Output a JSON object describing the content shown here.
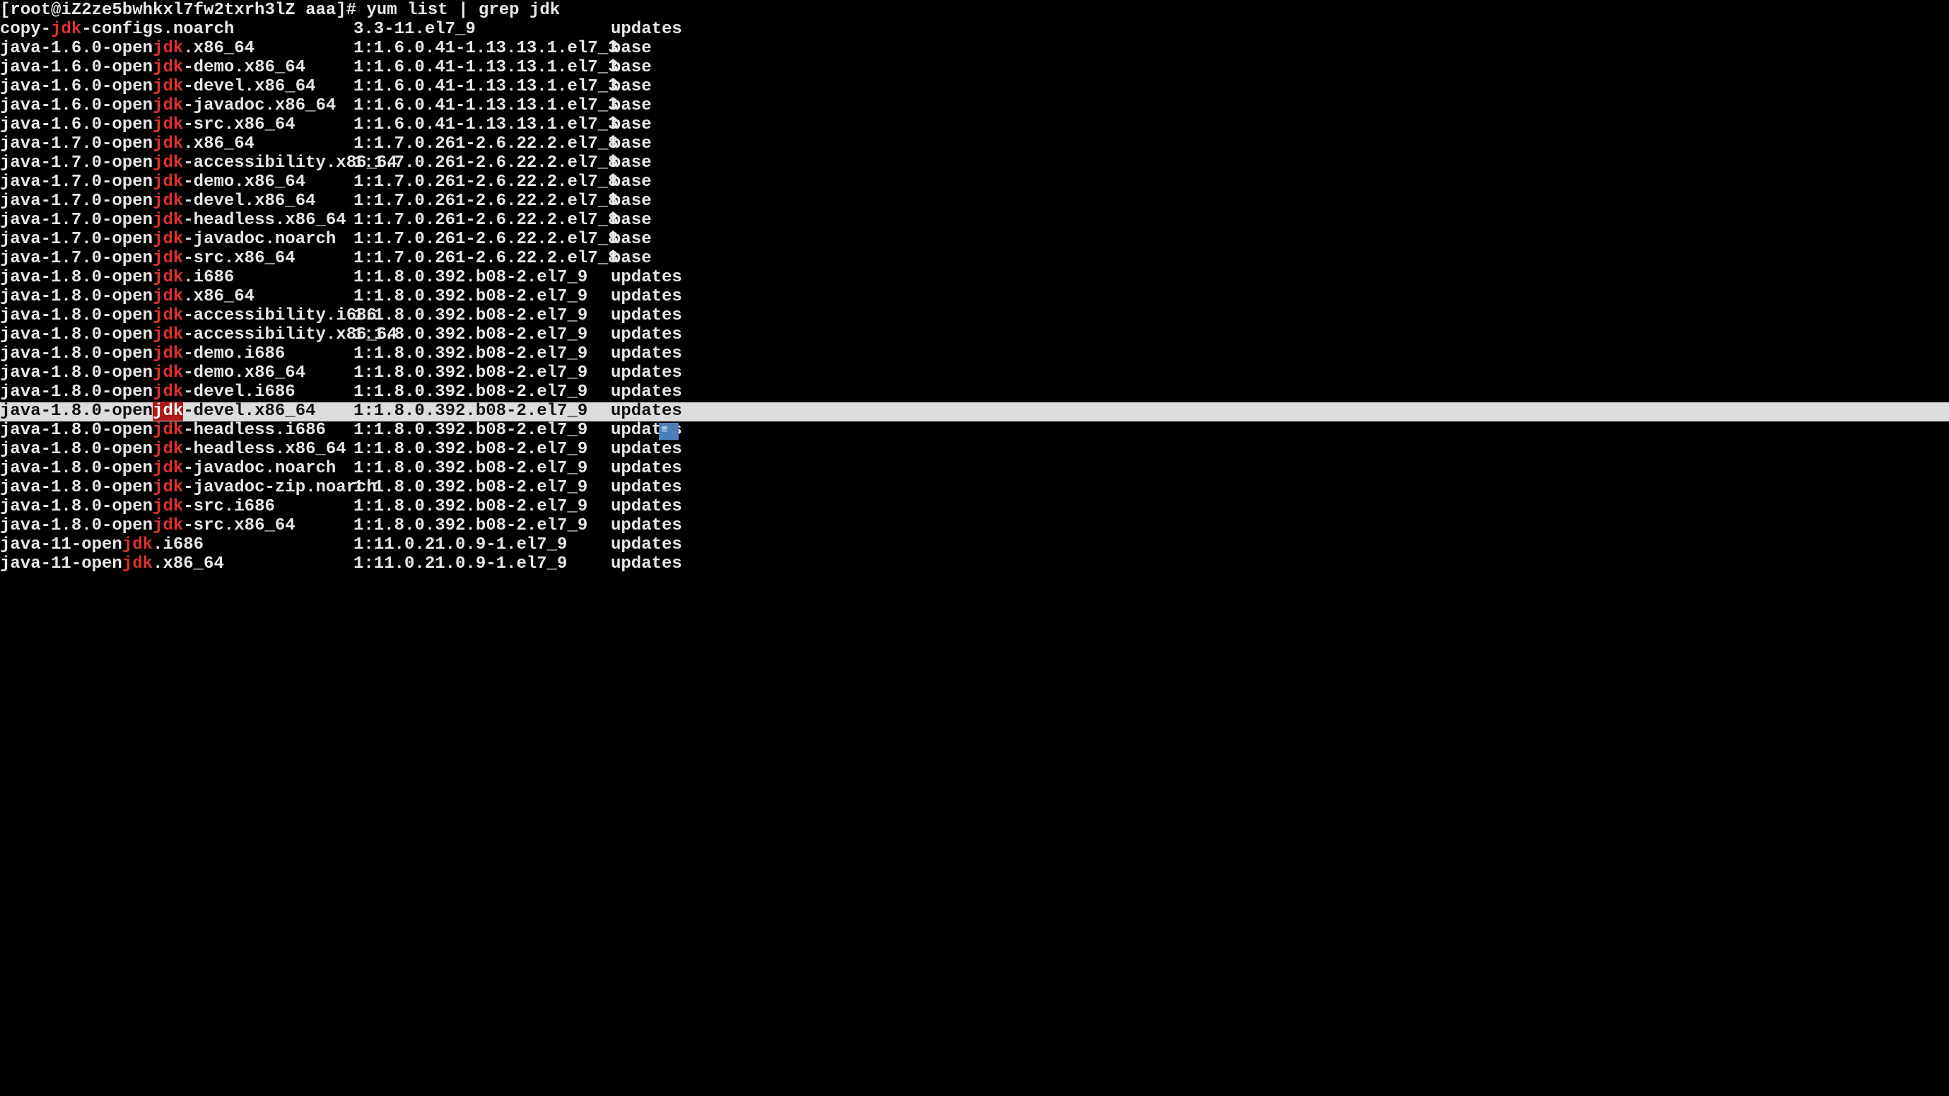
{
  "prompt": "[root@iZ2ze5bwhkxl7fw2txrh3lZ aaa]# yum list | grep jdk",
  "rows": [
    {
      "pre": "copy-",
      "mid": "jdk",
      "post": "-configs.noarch",
      "ver": "3.3-11.el7_9",
      "repo": "updates",
      "sel": false
    },
    {
      "pre": "java-1.6.0-open",
      "mid": "jdk",
      "post": ".x86_64",
      "ver": "1:1.6.0.41-1.13.13.1.el7_3",
      "repo": "base",
      "sel": false
    },
    {
      "pre": "java-1.6.0-open",
      "mid": "jdk",
      "post": "-demo.x86_64",
      "ver": "1:1.6.0.41-1.13.13.1.el7_3",
      "repo": "base",
      "sel": false
    },
    {
      "pre": "java-1.6.0-open",
      "mid": "jdk",
      "post": "-devel.x86_64",
      "ver": "1:1.6.0.41-1.13.13.1.el7_3",
      "repo": "base",
      "sel": false
    },
    {
      "pre": "java-1.6.0-open",
      "mid": "jdk",
      "post": "-javadoc.x86_64",
      "ver": "1:1.6.0.41-1.13.13.1.el7_3",
      "repo": "base",
      "sel": false
    },
    {
      "pre": "java-1.6.0-open",
      "mid": "jdk",
      "post": "-src.x86_64",
      "ver": "1:1.6.0.41-1.13.13.1.el7_3",
      "repo": "base",
      "sel": false
    },
    {
      "pre": "java-1.7.0-open",
      "mid": "jdk",
      "post": ".x86_64",
      "ver": "1:1.7.0.261-2.6.22.2.el7_8",
      "repo": "base",
      "sel": false
    },
    {
      "pre": "java-1.7.0-open",
      "mid": "jdk",
      "post": "-accessibility.x86_64",
      "ver": "1:1.7.0.261-2.6.22.2.el7_8",
      "repo": "base",
      "sel": false
    },
    {
      "pre": "java-1.7.0-open",
      "mid": "jdk",
      "post": "-demo.x86_64",
      "ver": "1:1.7.0.261-2.6.22.2.el7_8",
      "repo": "base",
      "sel": false
    },
    {
      "pre": "java-1.7.0-open",
      "mid": "jdk",
      "post": "-devel.x86_64",
      "ver": "1:1.7.0.261-2.6.22.2.el7_8",
      "repo": "base",
      "sel": false
    },
    {
      "pre": "java-1.7.0-open",
      "mid": "jdk",
      "post": "-headless.x86_64",
      "ver": "1:1.7.0.261-2.6.22.2.el7_8",
      "repo": "base",
      "sel": false
    },
    {
      "pre": "java-1.7.0-open",
      "mid": "jdk",
      "post": "-javadoc.noarch",
      "ver": "1:1.7.0.261-2.6.22.2.el7_8",
      "repo": "base",
      "sel": false
    },
    {
      "pre": "java-1.7.0-open",
      "mid": "jdk",
      "post": "-src.x86_64",
      "ver": "1:1.7.0.261-2.6.22.2.el7_8",
      "repo": "base",
      "sel": false
    },
    {
      "pre": "java-1.8.0-open",
      "mid": "jdk",
      "post": ".i686",
      "ver": "1:1.8.0.392.b08-2.el7_9",
      "repo": "updates",
      "sel": false
    },
    {
      "pre": "java-1.8.0-open",
      "mid": "jdk",
      "post": ".x86_64",
      "ver": "1:1.8.0.392.b08-2.el7_9",
      "repo": "updates",
      "sel": false
    },
    {
      "pre": "java-1.8.0-open",
      "mid": "jdk",
      "post": "-accessibility.i686",
      "ver": "1:1.8.0.392.b08-2.el7_9",
      "repo": "updates",
      "sel": false
    },
    {
      "pre": "java-1.8.0-open",
      "mid": "jdk",
      "post": "-accessibility.x86_64",
      "ver": "1:1.8.0.392.b08-2.el7_9",
      "repo": "updates",
      "sel": false
    },
    {
      "pre": "java-1.8.0-open",
      "mid": "jdk",
      "post": "-demo.i686",
      "ver": "1:1.8.0.392.b08-2.el7_9",
      "repo": "updates",
      "sel": false
    },
    {
      "pre": "java-1.8.0-open",
      "mid": "jdk",
      "post": "-demo.x86_64",
      "ver": "1:1.8.0.392.b08-2.el7_9",
      "repo": "updates",
      "sel": false
    },
    {
      "pre": "java-1.8.0-open",
      "mid": "jdk",
      "post": "-devel.i686",
      "ver": "1:1.8.0.392.b08-2.el7_9",
      "repo": "updates",
      "sel": false
    },
    {
      "pre": "java-1.8.0-open",
      "mid": "jdk",
      "post": "-devel.x86_64",
      "ver": "1:1.8.0.392.b08-2.el7_9",
      "repo": "updates",
      "sel": true
    },
    {
      "pre": "java-1.8.0-open",
      "mid": "jdk",
      "post": "-headless.i686",
      "ver": "1:1.8.0.392.b08-2.el7_9",
      "repo": "updates",
      "sel": false,
      "blob": true
    },
    {
      "pre": "java-1.8.0-open",
      "mid": "jdk",
      "post": "-headless.x86_64",
      "ver": "1:1.8.0.392.b08-2.el7_9",
      "repo": "updates",
      "sel": false
    },
    {
      "pre": "java-1.8.0-open",
      "mid": "jdk",
      "post": "-javadoc.noarch",
      "ver": "1:1.8.0.392.b08-2.el7_9",
      "repo": "updates",
      "sel": false
    },
    {
      "pre": "java-1.8.0-open",
      "mid": "jdk",
      "post": "-javadoc-zip.noarch",
      "ver": "1:1.8.0.392.b08-2.el7_9",
      "repo": "updates",
      "sel": false
    },
    {
      "pre": "java-1.8.0-open",
      "mid": "jdk",
      "post": "-src.i686",
      "ver": "1:1.8.0.392.b08-2.el7_9",
      "repo": "updates",
      "sel": false
    },
    {
      "pre": "java-1.8.0-open",
      "mid": "jdk",
      "post": "-src.x86_64",
      "ver": "1:1.8.0.392.b08-2.el7_9",
      "repo": "updates",
      "sel": false
    },
    {
      "pre": "java-11-open",
      "mid": "jdk",
      "post": ".i686",
      "ver": "1:11.0.21.0.9-1.el7_9",
      "repo": "updates",
      "sel": false
    },
    {
      "pre": "java-11-open",
      "mid": "jdk",
      "post": ".x86_64",
      "ver": "1:11.0.21.0.9-1.el7_9",
      "repo": "updates",
      "sel": false
    }
  ]
}
